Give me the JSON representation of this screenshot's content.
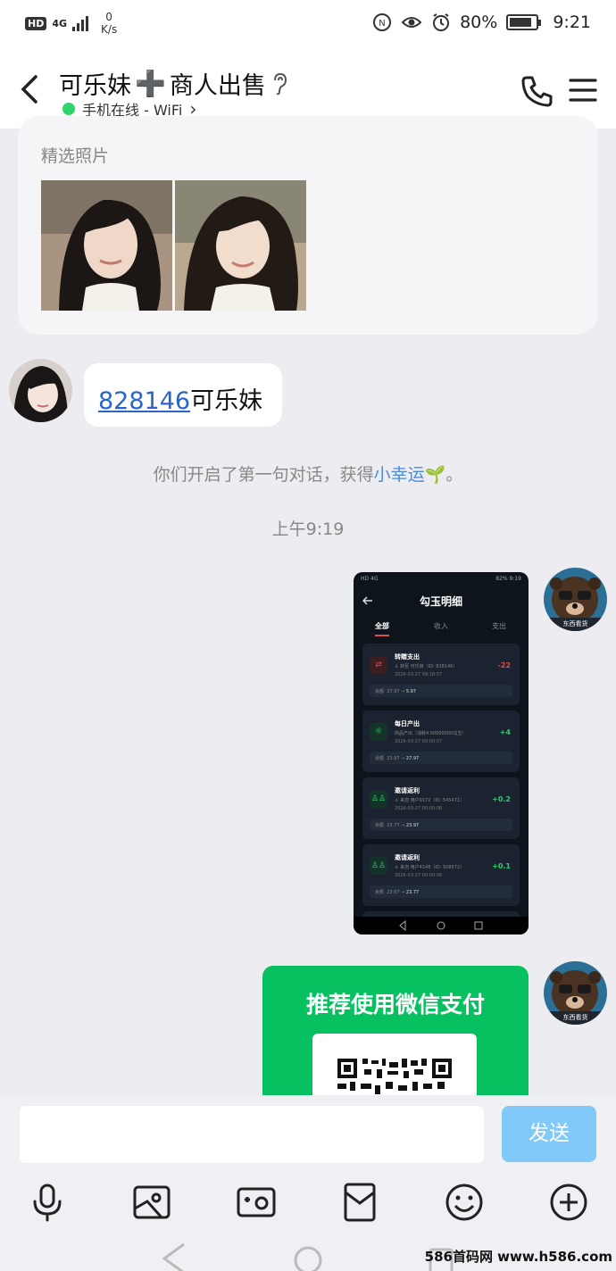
{
  "status_bar": {
    "hd": "HD",
    "network": "4G",
    "speed_value": "0",
    "speed_unit": "K/s",
    "battery": "80%",
    "time": "9:21"
  },
  "header": {
    "title_part1": "可乐妹",
    "title_emoji": "➕",
    "title_part2": "商人出售",
    "status": "手机在线 - WiFi",
    "status_arrow": "›"
  },
  "profile_card": {
    "label": "精选照片"
  },
  "messages": {
    "friend_link": "828146",
    "friend_text": "可乐妹",
    "system_notice_pre": "你们开启了第一句对话，获得",
    "system_notice_highlight": "小幸运",
    "system_notice_emoji": "🌱",
    "system_notice_post": "。",
    "timestamp": "上午9:19",
    "avatar_caption": "东西看货"
  },
  "screenshot_msg": {
    "status_left": "HD 4G",
    "status_right": "82% 9:19",
    "title": "勾玉明细",
    "tabs": [
      "全部",
      "收入",
      "支出"
    ],
    "records": [
      {
        "title": "转赠支出",
        "detail": "♙ 转至 可乐妹（ID: 828146）",
        "date": "2026-03-27 09:18:57",
        "amount": "-22",
        "bal_label": "余额",
        "bal_from": "27.97",
        "bal_to": "5.97"
      },
      {
        "title": "每日产出",
        "detail": "商品产出（消耗4.00000000勾玉）",
        "date": "2026-03-27 00:00:07",
        "amount": "+4",
        "bal_label": "余额",
        "bal_from": "23.97",
        "bal_to": "27.97"
      },
      {
        "title": "邀请返利",
        "detail": "♙ 来自 用户9172（ID: 545471）",
        "date": "2026-03-27 00:00:06",
        "amount": "+0.2",
        "bal_label": "余额",
        "bal_from": "23.77",
        "bal_to": "23.97"
      },
      {
        "title": "邀请返利",
        "detail": "♙ 来自 用户4148（ID: 508672）",
        "date": "2026-03-27 00:00:06",
        "amount": "+0.1",
        "bal_label": "余额",
        "bal_from": "23.67",
        "bal_to": "23.77"
      }
    ]
  },
  "wechat_msg": {
    "title": "推荐使用微信支付"
  },
  "input": {
    "placeholder": "",
    "send_label": "发送"
  },
  "watermark": "586首码网 www.h586.com",
  "colors": {
    "link": "#2a64c8",
    "online": "#2ed46b",
    "wechat": "#07c160",
    "send": "#81c9f8",
    "negative": "#e5484d",
    "positive": "#2ecc71"
  }
}
